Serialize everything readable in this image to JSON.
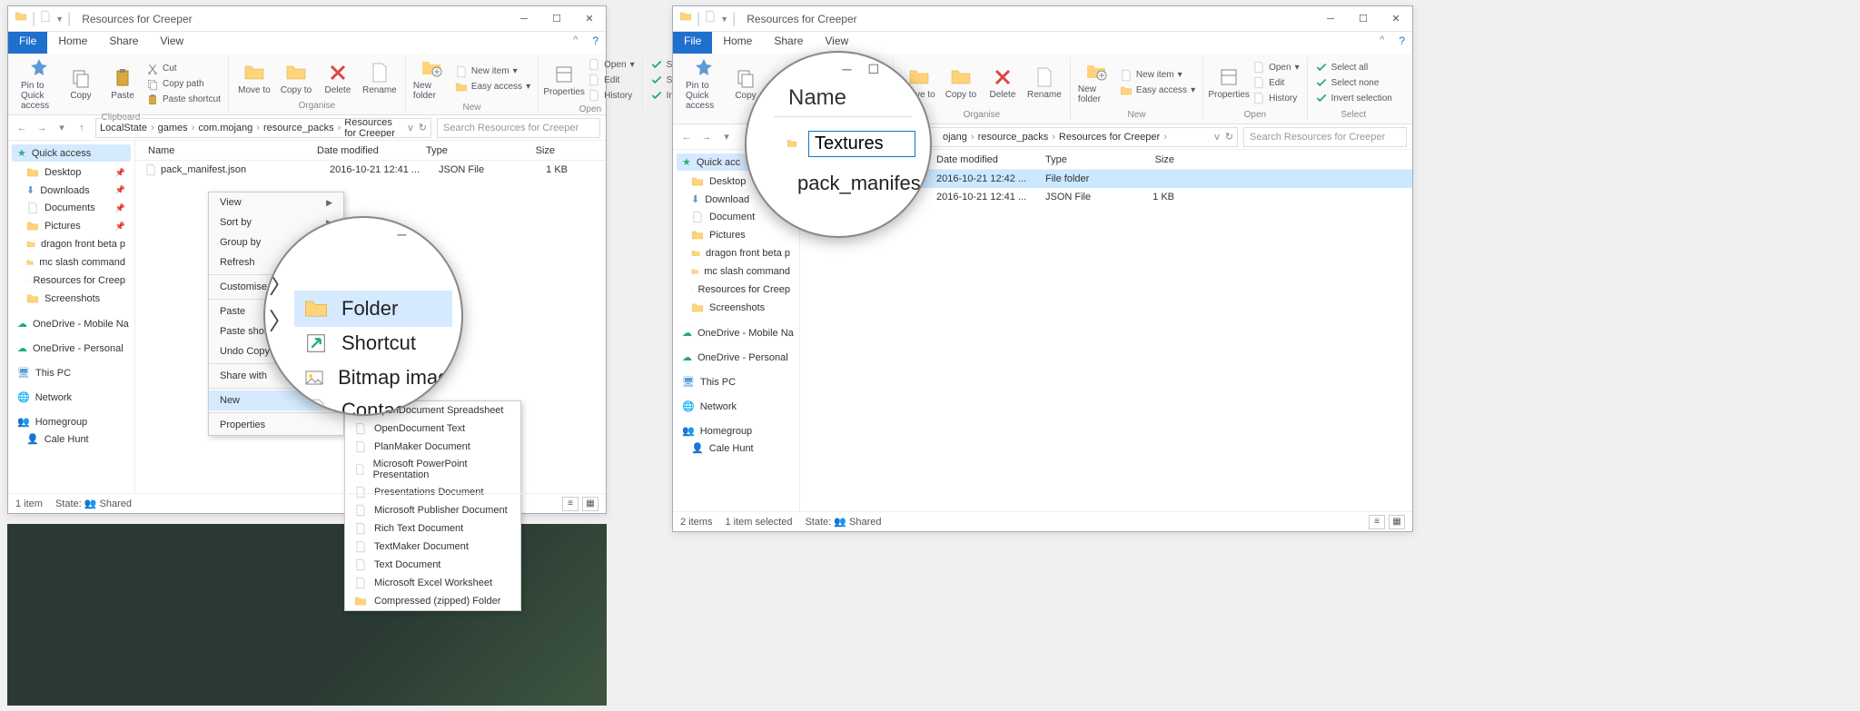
{
  "window_title": "Resources for Creeper",
  "tabs": {
    "file": "File",
    "home": "Home",
    "share": "Share",
    "view": "View"
  },
  "ribbon": {
    "clipboard": {
      "label": "Clipboard",
      "pin": "Pin to Quick access",
      "copy": "Copy",
      "paste": "Paste",
      "cut": "Cut",
      "copy_path": "Copy path",
      "paste_shortcut": "Paste shortcut"
    },
    "organise": {
      "label": "Organise",
      "move": "Move to",
      "copy_to": "Copy to",
      "delete": "Delete",
      "rename": "Rename"
    },
    "new": {
      "label": "New",
      "new_folder": "New folder",
      "new_item": "New item",
      "easy_access": "Easy access"
    },
    "open": {
      "label": "Open",
      "properties": "Properties",
      "open": "Open",
      "edit": "Edit",
      "history": "History"
    },
    "select": {
      "label": "Select",
      "select_all": "Select all",
      "select_none": "Select none",
      "invert": "Invert selection"
    }
  },
  "breadcrumbs": [
    "LocalState",
    "games",
    "com.mojang",
    "resource_packs",
    "Resources for Creeper"
  ],
  "search_placeholder": "Search Resources for Creeper",
  "columns": {
    "name": "Name",
    "date": "Date modified",
    "type": "Type",
    "size": "Size"
  },
  "files_left": [
    {
      "name": "pack_manifest.json",
      "date": "2016-10-21 12:41 ...",
      "type": "JSON File",
      "size": "1 KB",
      "icon": "file"
    }
  ],
  "files_right": [
    {
      "name": "Textures",
      "date": "2016-10-21 12:42 ...",
      "type": "File folder",
      "size": "",
      "icon": "folder",
      "selected": true,
      "editing": true
    },
    {
      "name": "pack_manifest.json",
      "date": "2016-10-21 12:41 ...",
      "type": "JSON File",
      "size": "1 KB",
      "icon": "file"
    }
  ],
  "sidebar": {
    "quick_access": "Quick access",
    "items": [
      "Desktop",
      "Downloads",
      "Documents",
      "Pictures",
      "dragon front beta p",
      "mc slash command",
      "Resources for Creep",
      "Screenshots"
    ],
    "onedrive_m": "OneDrive - Mobile Na",
    "onedrive_p": "OneDrive - Personal",
    "thispc": "This PC",
    "network": "Network",
    "homegroup": "Homegroup",
    "user": "Cale Hunt"
  },
  "context_menu": {
    "view": "View",
    "sort": "Sort by",
    "group": "Group by",
    "refresh": "Refresh",
    "customise": "Customise this folder...",
    "paste": "Paste",
    "paste_shortcut": "Paste shortcut",
    "undo": "Undo Copy",
    "share": "Share with",
    "new": "New",
    "properties": "Properties"
  },
  "new_submenu": {
    "folder": "Folder",
    "shortcut": "Shortcut",
    "bitmap": "Bitmap image",
    "contact": "Contact",
    "odspread": "OpenDocument Spreadsheet",
    "odtext": "OpenDocument Text",
    "planmaker": "PlanMaker Document",
    "powerpoint": "Microsoft PowerPoint Presentation",
    "presentations": "Presentations Document",
    "publisher": "Microsoft Publisher Document",
    "rtf": "Rich Text Document",
    "textmaker": "TextMaker Document",
    "textdoc": "Text Document",
    "excel": "Microsoft Excel Worksheet",
    "zip": "Compressed (zipped) Folder"
  },
  "status_left": {
    "items": "1 item",
    "state": "State:",
    "shared": "Shared"
  },
  "status_right": {
    "items": "2 items",
    "selected": "1 item selected",
    "state": "State:",
    "shared": "Shared"
  },
  "magnifier2": {
    "name_header": "Name",
    "textures": "Textures",
    "manifest": "pack_manifes"
  }
}
